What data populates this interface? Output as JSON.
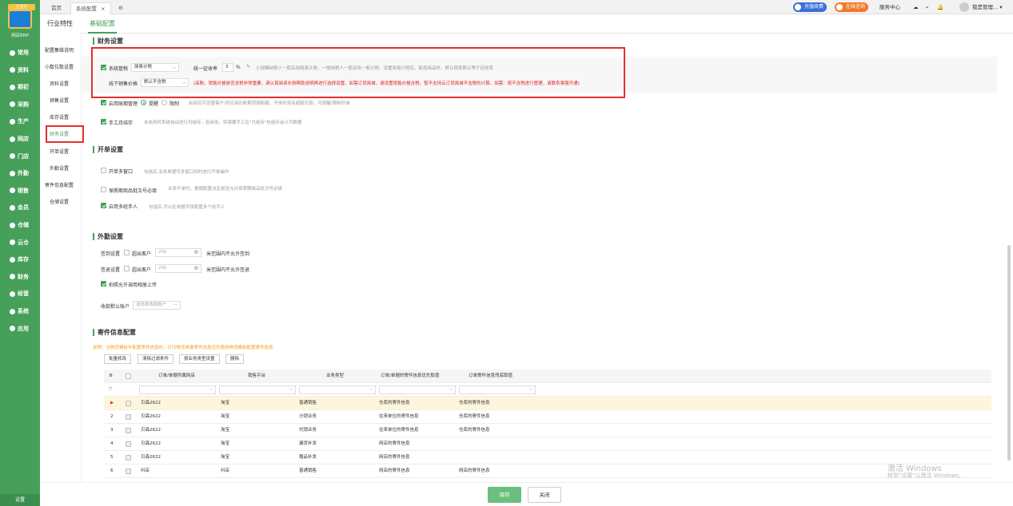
{
  "sidebar": {
    "logo_tag": "万里牛",
    "logo_text": "网店ERP",
    "items": [
      "常用",
      "资料",
      "期初",
      "采购",
      "生产",
      "网店",
      "门店",
      "外勤",
      "销售",
      "会员",
      "仓储",
      "云仓",
      "库存",
      "财务",
      "经营",
      "系统",
      "应用"
    ],
    "bottom": "设置"
  },
  "topbar": {
    "tabs": [
      "首页",
      "系统配置"
    ],
    "close": "×",
    "recharge": "充值续费",
    "consult": "在线咨询",
    "service": "服务中心",
    "user": "我是管理..."
  },
  "page": {
    "left_title": "行业特性",
    "active_tab": "基础配置"
  },
  "submenu": [
    "配置集维说明",
    "小数位数设置",
    "资料设置",
    "销售设置",
    "库存设置",
    "财务设置",
    "开单设置",
    "外勤设置",
    "寄件信息配置",
    "仓储设置"
  ],
  "finance": {
    "title": "财务设置",
    "system_tax": "系统管税",
    "tax_mode": "简易计税",
    "unified_rate_label": "统一征收率",
    "rate": "3",
    "pct": "%",
    "rate_hint": "小规模纳税人一般采用简易计税，一般纳税人一般采用一般计税。设置简易计税后，新增商品时，默认税率默认等于征收率",
    "offline_price_label": "线下销售价格",
    "offline_price": "默认不含税",
    "red_note": "(采购、销售价格是否含税非常重要，请认真阅读右侧帮助说明再进行选择设置。如需订货商城，请设置销售价格含税，暂不支持云订货商城不含税的计算。如需：按不含税进行管理，请联系客服开通)",
    "credit_label": "启用账期管理",
    "credit_opt1": "提醒",
    "credit_opt2": "限制",
    "credit_hint": "启用后可设置客户/供应商的账期范围和额，开单时若有超额欠款，可提醒/限制开单",
    "manual_label": "手工月结存",
    "manual_hint": "未启用时系统自动进行月结存，若启用，则需要手工在\"月结存\"处结存会计月数据"
  },
  "order": {
    "title": "开单设置",
    "multi_window": "开单多窗口",
    "multi_window_hint": "勾选后,业务单据可多窗口同时进行开单操作",
    "batch_required": "保质期商品批次号必填",
    "batch_hint": "业务开单时，根据配置决定是否允许保质期商品批次号必填",
    "multi_agent": "启用多经手人",
    "multi_agent_hint": "勾选后,可以在单据字段配置多个经手人"
  },
  "field": {
    "title": "外勤设置",
    "checkin": "签到设置",
    "checkout": "签退设置",
    "beyond": "超出客户",
    "dist": "200",
    "checkin_hint": "米范围内不允许签到",
    "checkout_hint": "米范围内不允许签退",
    "photo": "拍照允许调用相册上传",
    "account_label": "收款默认账户",
    "account_ph": "请选择收款账户"
  },
  "shipping": {
    "title": "寄件信息配置",
    "note": "说明：当物流模板中配置寄件信息时，打印物流单据寄件信息优先使用物流模板配置寄件信息",
    "btns": [
      "批量修改",
      "清除过滤条件",
      "按业务类型设置",
      "删除"
    ],
    "headers": [
      "订单/单据所属网店",
      "销售平台",
      "业务类型",
      "订单/单据的寄件信息优先取值",
      "订单寄件信息兜底取值"
    ],
    "rows": [
      {
        "no": "▶",
        "shop": "贝森2622",
        "platform": "淘宝",
        "type": "普通销售",
        "first": "仓库的寄件信息",
        "fallback": "仓库的寄件信息"
      },
      {
        "no": "2",
        "shop": "贝森2622",
        "platform": "淘宝",
        "type": "分销业务",
        "first": "往来单位的寄件信息",
        "fallback": "仓库的寄件信息"
      },
      {
        "no": "3",
        "shop": "贝森2622",
        "platform": "淘宝",
        "type": "代销业务",
        "first": "往来单位的寄件信息",
        "fallback": "仓库的寄件信息"
      },
      {
        "no": "4",
        "shop": "贝森2622",
        "platform": "淘宝",
        "type": "漏货补发",
        "first": "网店的寄件信息",
        "fallback": ""
      },
      {
        "no": "5",
        "shop": "贝森2622",
        "platform": "淘宝",
        "type": "赠品补发",
        "first": "网店的寄件信息",
        "fallback": ""
      },
      {
        "no": "6",
        "shop": "抖店",
        "platform": "抖店",
        "type": "普通销售",
        "first": "网店的寄件信息",
        "fallback": "网店的寄件信息"
      }
    ]
  },
  "footer": {
    "save": "保存",
    "close": "关闭"
  },
  "watermark": {
    "line1": "激活 Windows",
    "line2": "转到\"设置\"以激活 Windows。"
  },
  "colors": {
    "brand": "#46a05a",
    "alert": "#e03030"
  }
}
